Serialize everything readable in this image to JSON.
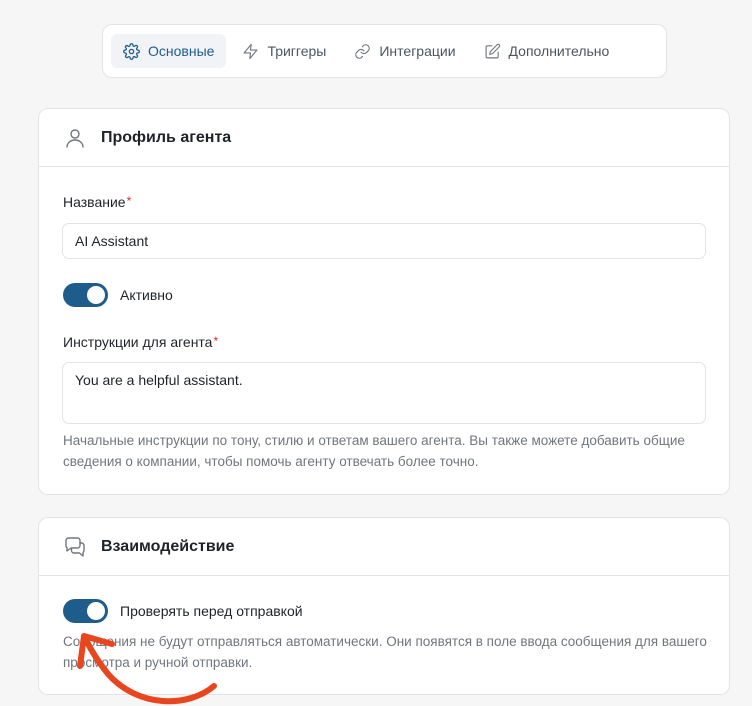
{
  "tabs": [
    {
      "label": "Основные",
      "icon": "gear-icon",
      "active": true
    },
    {
      "label": "Триггеры",
      "icon": "lightning-icon",
      "active": false
    },
    {
      "label": "Интеграции",
      "icon": "link-icon",
      "active": false
    },
    {
      "label": "Дополнительно",
      "icon": "edit-icon",
      "active": false
    }
  ],
  "profile": {
    "title": "Профиль агента",
    "icon": "user-icon",
    "name_label": "Название",
    "name_required_mark": "*",
    "name_value": "AI Assistant",
    "active_label": "Активно",
    "active_on": true,
    "instructions_label": "Инструкции для агента",
    "instructions_required_mark": "*",
    "instructions_value": "You are a helpful assistant.",
    "instructions_help": "Начальные инструкции по тону, стилю и ответам вашего агента. Вы также можете добавить общие сведения о компании, чтобы помочь агенту отвечать более точно."
  },
  "interaction": {
    "title": "Взаимодействие",
    "icon": "chat-bubbles-icon",
    "review_label": "Проверять перед отправкой",
    "review_on": true,
    "review_help": "Сообщения не будут отправляться автоматически. Они появятся в поле ввода сообщения для вашего просмотра и ручной отправки."
  },
  "colors": {
    "accent": "#1e5c8c",
    "annotation_arrow": "#e8461e",
    "required": "#dc2626"
  }
}
